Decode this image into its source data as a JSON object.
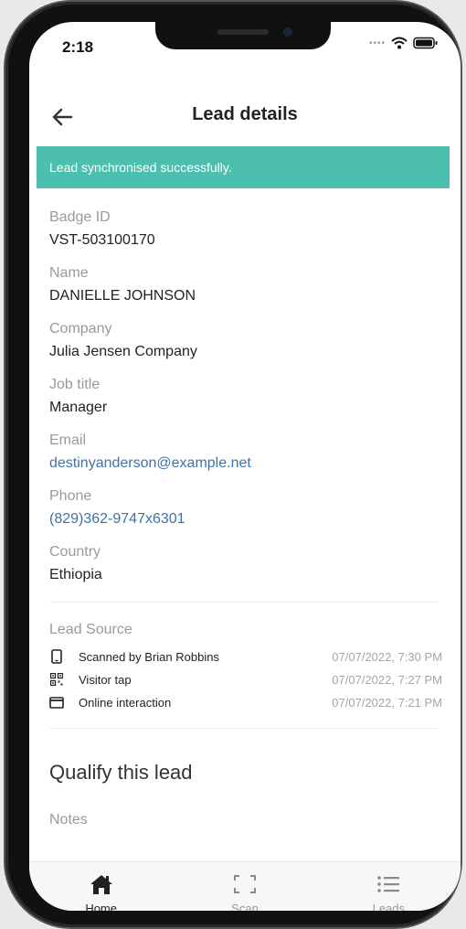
{
  "status_bar": {
    "time": "2:18"
  },
  "header": {
    "title": "Lead details"
  },
  "banner": {
    "text": "Lead synchronised successfully."
  },
  "fields": [
    {
      "label": "Badge ID",
      "value": "VST-503100170"
    },
    {
      "label": "Name",
      "value": "DANIELLE JOHNSON"
    },
    {
      "label": "Company",
      "value": "Julia Jensen Company"
    },
    {
      "label": "Job title",
      "value": "Manager"
    },
    {
      "label": "Email",
      "value": "destinyanderson@example.net"
    },
    {
      "label": "Phone",
      "value": "(829)362-9747x6301"
    },
    {
      "label": "Country",
      "value": "Ethiopia"
    }
  ],
  "lead_source": {
    "title": "Lead Source",
    "entries": [
      {
        "icon": "phone-icon",
        "text": "Scanned by Brian Robbins",
        "timestamp": "07/07/2022, 7:30 PM"
      },
      {
        "icon": "qr-code-icon",
        "text": "Visitor tap",
        "timestamp": "07/07/2022, 7:27 PM"
      },
      {
        "icon": "browser-window-icon",
        "text": "Online interaction",
        "timestamp": "07/07/2022, 7:21 PM"
      }
    ]
  },
  "qualify": {
    "title": "Qualify this lead",
    "notes_label": "Notes"
  },
  "tabs": [
    {
      "label": "Home",
      "icon": "home-icon",
      "active": true
    },
    {
      "label": "Scan",
      "icon": "scan-icon",
      "active": false
    },
    {
      "label": "Leads",
      "icon": "list-icon",
      "active": false
    }
  ],
  "colors": {
    "banner": "#4dbfae",
    "link": "#3f73a8",
    "label": "#9a9a9a"
  }
}
